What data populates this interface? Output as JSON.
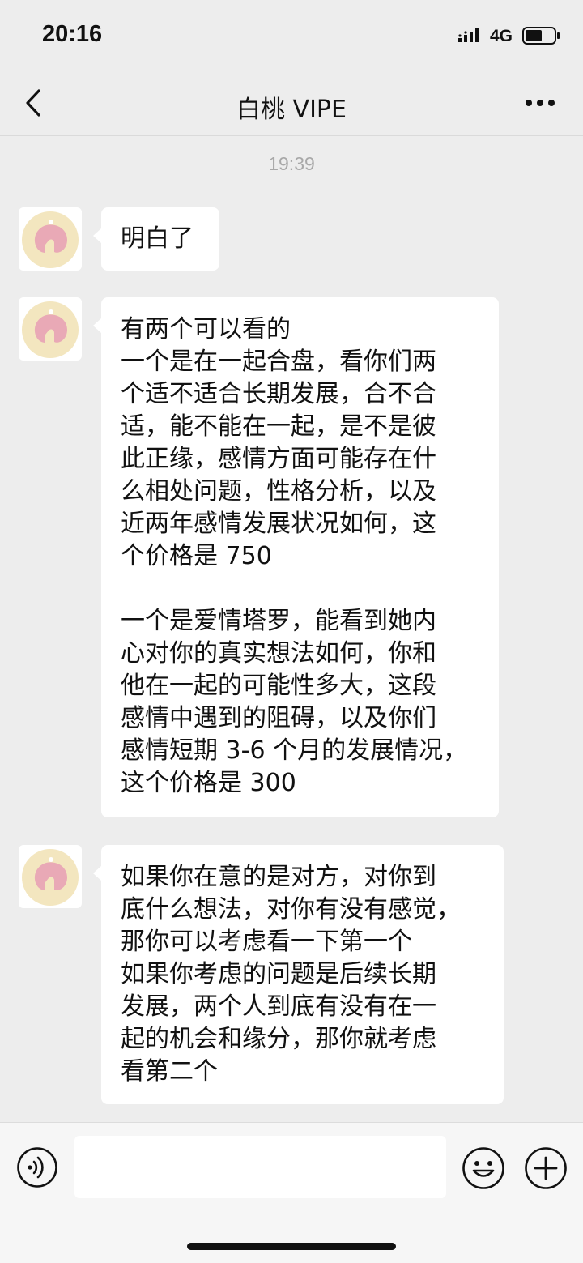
{
  "status_bar": {
    "time": "20:16",
    "network": "4G",
    "icons": [
      "signal-icon",
      "battery-icon"
    ]
  },
  "nav": {
    "title": "白桃 VIPE",
    "back_icon": "back-chevron-icon",
    "more_icon": "more-dots-icon"
  },
  "chat": {
    "timestamp": "19:39",
    "messages": [
      {
        "sender": "other",
        "text": "明白了"
      },
      {
        "sender": "other",
        "text": "有两个可以看的\n一个是在一起合盘，看你们两\n个适不适合长期发展，合不合\n适，能不能在一起，是不是彼\n此正缘，感情方面可能存在什\n么相处问题，性格分析，以及\n近两年感情发展状况如何，这\n个价格是 750\n\n一个是爱情塔罗，能看到她内\n心对你的真实想法如何，你和\n他在一起的可能性多大，这段\n感情中遇到的阻碍，以及你们\n感情短期 3-6 个月的发展情况，\n这个价格是 300"
      },
      {
        "sender": "other",
        "text": "如果你在意的是对方，对你到\n底什么想法，对你有没有感觉，\n那你可以考虑看一下第一个\n如果你考虑的问题是后续长期\n发展，两个人到底有没有在一\n起的机会和缘分，那你就考虑\n看第二个"
      }
    ]
  },
  "input_bar": {
    "value": "",
    "icons": [
      "voice-icon",
      "emoji-icon",
      "plus-icon"
    ]
  },
  "colors": {
    "background": "#ededed",
    "bubble": "#ffffff",
    "avatar_peach": "#f3e6bf",
    "avatar_pink": "#e9a9b6"
  }
}
